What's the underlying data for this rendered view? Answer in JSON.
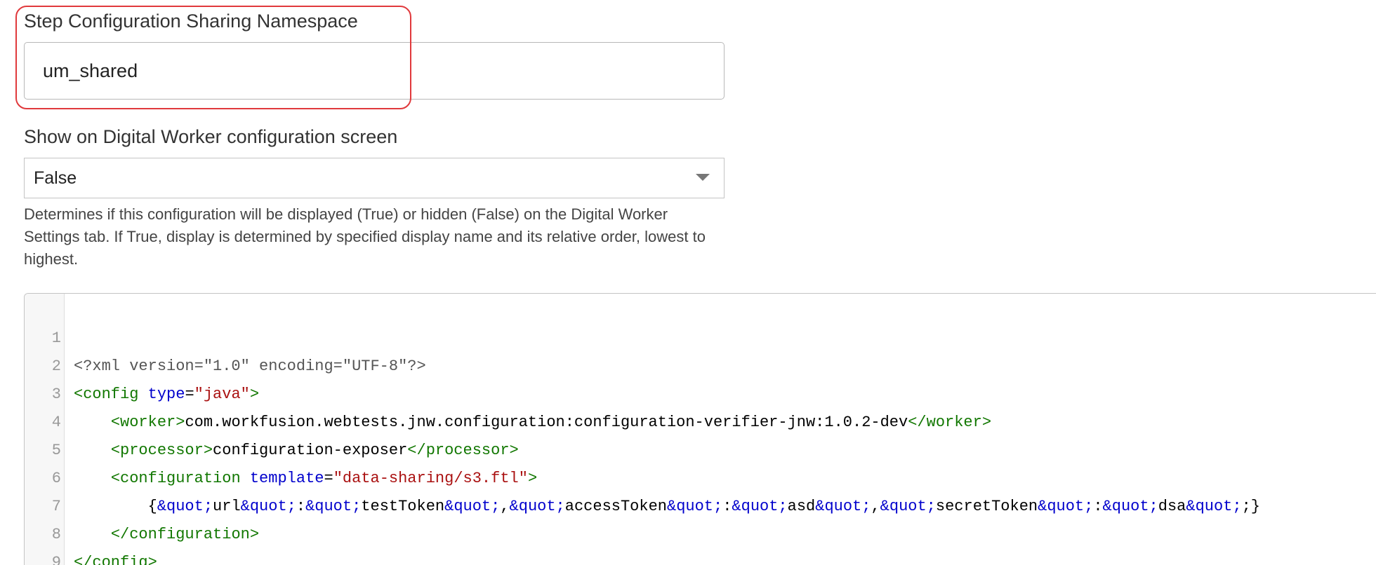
{
  "namespace_field": {
    "label": "Step Configuration Sharing Namespace",
    "value": "um_shared"
  },
  "show_field": {
    "label": "Show on Digital Worker configuration screen",
    "selected": "False",
    "help": "Determines if this configuration will be displayed (True) or hidden (False) on the Digital Worker Settings tab. If True, display is determined by specified display name and its relative order, lowest to highest."
  },
  "colors": {
    "highlight": "#e0393c",
    "tag": "#117700",
    "attr": "#0000cc",
    "string": "#aa1111"
  },
  "editor": {
    "line_numbers": [
      "1",
      "2",
      "3",
      "4",
      "5",
      "6",
      "7",
      "8",
      "9"
    ],
    "l1": {
      "meta": "<?xml version=\"1.0\" encoding=\"UTF-8\"?>"
    },
    "l2": {
      "open": "<config",
      "attr": " type",
      "eq": "=",
      "val": "\"java\"",
      "close": ">"
    },
    "l3": {
      "indent": "    ",
      "open": "<worker>",
      "text": "com.workfusion.webtests.jnw.configuration:configuration-verifier-jnw:1.0.2-dev",
      "close": "</worker>"
    },
    "l4": {
      "indent": "    ",
      "open": "<processor>",
      "text": "configuration-exposer",
      "close": "</processor>"
    },
    "l5": {
      "indent": "    ",
      "open": "<configuration",
      "attr": " template",
      "eq": "=",
      "val": "\"data-sharing/s3.ftl\"",
      "close": ">"
    },
    "l6": {
      "indent": "        ",
      "t1": "{",
      "e1": "&quot;",
      "t2": "url",
      "e2": "&quot;",
      "t3": ":",
      "e3": "&quot;",
      "t4": "testToken",
      "e4": "&quot;",
      "t5": ",",
      "e5": "&quot;",
      "t6": "accessToken",
      "e6": "&quot;",
      "t7": ":",
      "e7": "&quot;",
      "t8": "asd",
      "e8": "&quot;",
      "t9": ",",
      "e9": "&quot;",
      "t10": "secretToken",
      "e10": "&quot;",
      "t11": ":",
      "e11": "&quot;",
      "t12": "dsa",
      "e12": "&quot;",
      "t13": ";}"
    },
    "l7": {
      "indent": "    ",
      "close": "</configuration>"
    },
    "l8": {
      "close": "</config>"
    }
  }
}
